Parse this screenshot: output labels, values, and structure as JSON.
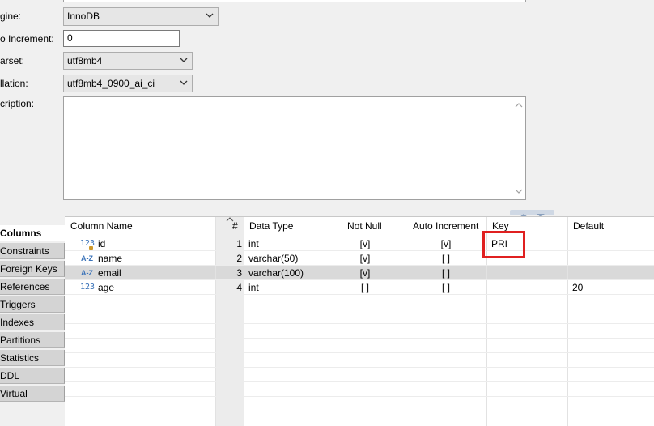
{
  "properties": {
    "engine": {
      "label": "gine:",
      "value": "InnoDB"
    },
    "auto_increment": {
      "label": "o Increment:",
      "value": "0"
    },
    "charset": {
      "label": "arset:",
      "value": "utf8mb4"
    },
    "collation": {
      "label": "llation:",
      "value": "utf8mb4_0900_ai_ci"
    },
    "description": {
      "label": "cription:",
      "value": ""
    }
  },
  "tabs": [
    {
      "label": "Columns",
      "active": true
    },
    {
      "label": "Constraints"
    },
    {
      "label": "Foreign Keys"
    },
    {
      "label": "References"
    },
    {
      "label": "Triggers"
    },
    {
      "label": "Indexes"
    },
    {
      "label": "Partitions"
    },
    {
      "label": "Statistics"
    },
    {
      "label": "DDL"
    },
    {
      "label": "Virtual"
    }
  ],
  "grid": {
    "headers": {
      "column_name": "Column Name",
      "num": "#",
      "data_type": "Data Type",
      "not_null": "Not Null",
      "auto_increment": "Auto Increment",
      "key": "Key",
      "default": "Default"
    },
    "rows": [
      {
        "icon": "123",
        "name": "id",
        "num": "1",
        "type": "int",
        "not_null": "[v]",
        "auto_inc": "[v]",
        "key": "PRI",
        "default": ""
      },
      {
        "icon": "A-Z",
        "name": "name",
        "num": "2",
        "type": "varchar(50)",
        "not_null": "[v]",
        "auto_inc": "[ ]",
        "key": "",
        "default": ""
      },
      {
        "icon": "A-Z",
        "name": "email",
        "num": "3",
        "type": "varchar(100)",
        "not_null": "[v]",
        "auto_inc": "[ ]",
        "key": "",
        "default": ""
      },
      {
        "icon": "123",
        "name": "age",
        "num": "4",
        "type": "int",
        "not_null": "[ ]",
        "auto_inc": "[ ]",
        "key": "",
        "default": "20"
      }
    ]
  },
  "colors": {
    "highlight": "#e02020",
    "selected_row": "#d9d9d9",
    "type_icon": "#3b73b9"
  }
}
